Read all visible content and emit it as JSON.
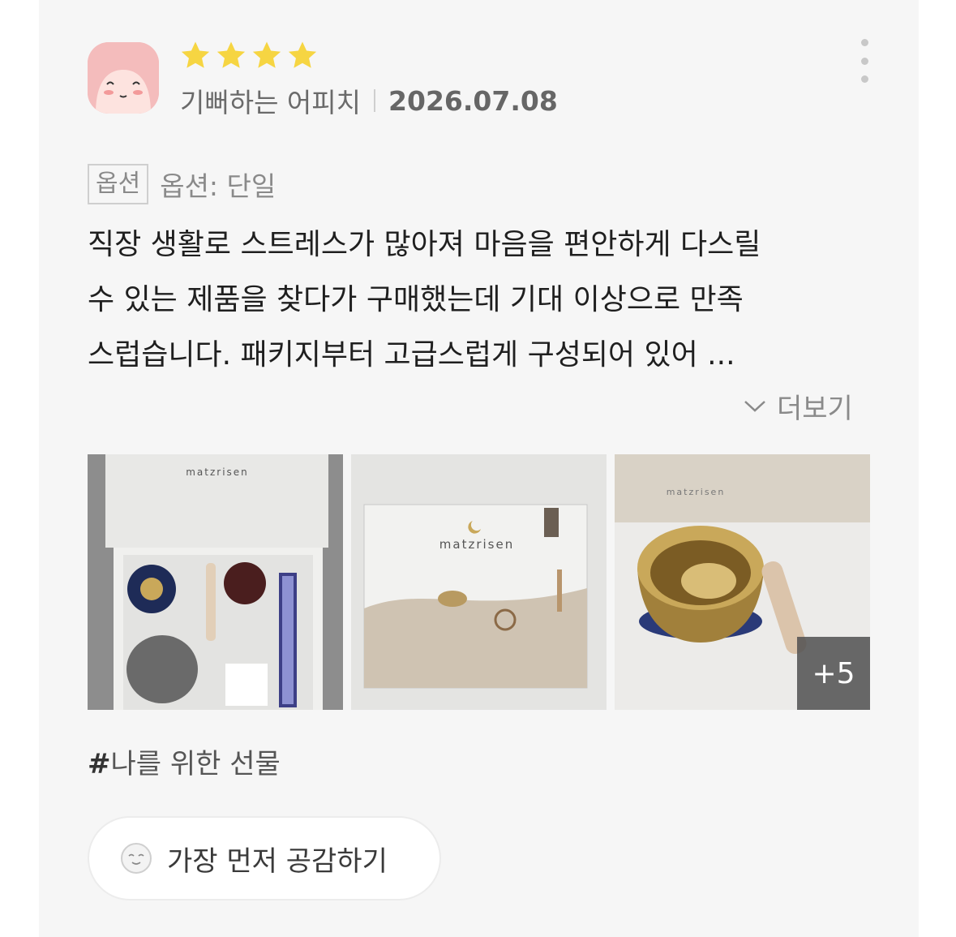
{
  "review": {
    "author": "기뻐하는 어피치",
    "date": "2026.07.08",
    "rating": 4,
    "option_tag": "옵션",
    "option_value": "옵션: 단일",
    "text_lines": [
      "직장 생활로 스트레스가 많아져 마음을 편안하게 다스릴",
      "수 있는 제품을 찾다가 구매했는데 기대 이상으로 만족",
      "스럽습니다. 패키지부터 고급스럽게 구성되어 있어 ..."
    ],
    "more_label": "더보기",
    "photos": [
      {
        "brand": "matzrisen"
      },
      {
        "brand": "matzrisen"
      },
      {
        "brand": "matzrisen",
        "extra_count": "+5"
      }
    ],
    "hashtag_mark": "#",
    "hashtag_text": "나를 위한 선물",
    "empathy_label": "가장 먼저 공감하기"
  },
  "icons": {
    "star": "star-icon",
    "kebab": "more-vert-icon",
    "chevron": "chevron-down-icon",
    "smiley": "smile-face-icon"
  },
  "colors": {
    "star": "#f6d542",
    "avatar": "#f4bcbc",
    "background": "#f6f6f6",
    "text": "#1f1f1f",
    "muted": "#8a8a8a"
  }
}
